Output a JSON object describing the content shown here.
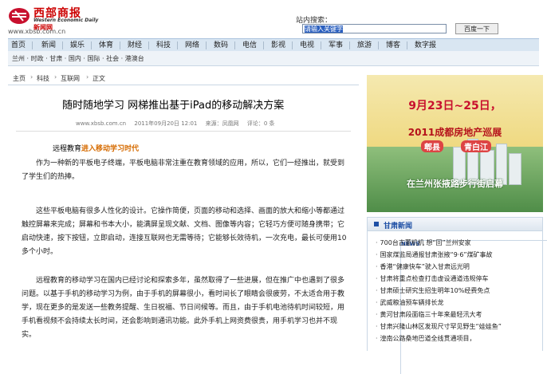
{
  "header": {
    "logo_cn": "西部商报",
    "logo_en": "Western Economic Daily",
    "logo_sub": "新闻网",
    "logo_news": "NEWS",
    "logo_url": "www.xbsb.com.cn",
    "search_label": "站内搜索：",
    "search_placeholder": "请输入关键字",
    "search_button": "百度一下"
  },
  "nav": {
    "items": [
      "首页",
      "新闻",
      "娱乐",
      "体育",
      "财经",
      "科技",
      "网络",
      "数码",
      "电信",
      "影视",
      "电视",
      "军事",
      "旅游",
      "博客",
      "数字报"
    ]
  },
  "subnav": {
    "text": "兰州 · 时政 · 甘肃 · 国内 · 国际 · 社会 · 港澳台"
  },
  "breadcrumb": {
    "items": [
      "主页",
      "科技",
      "互联网",
      "正文"
    ]
  },
  "article": {
    "title": "随时随地学习 网梯推出基于iPad的移动解决方案",
    "meta_site": "www.xbsb.com.cn",
    "meta_time": "2011年09月20日 12:01",
    "meta_source": "来源：凤凰网",
    "meta_comments": "评论：0 条",
    "lead_prefix": "远程教育",
    "lead_highlight": "进入移动学习时代",
    "paragraphs": [
      "作为一种新的平板电子终端，平板电脑非常注重在教育领域的应用，所以，它们一经推出，就受到了学生们的热捧。",
      "这些平板电脑有很多人性化的设计。它操作简便，页面的移动和选择、画面的放大和缩小等都通过触控屏幕来完成；屏幕和书本大小，能满屏呈现文献、文档、图像等内容；它轻巧方便可随身携带；它启动快速，按下按钮，立即启动，连接互联网也无需等待；它能够长效待机，一次充电，最长可使用10多个小时。",
      "远程教育的移动学习在国内已经讨论和探索多年，虽然取得了一些进展，但在推广中也遇到了很多问题。以基于手机的移动学习为例，由于手机的屏幕很小，看时间长了眼睛会很疲劳，不太适合用于教学，现在更多的是发送一些教务提醒、生日祝福、节日问候等。而且，由于手机电池待机时间较短，用手机看视频不会持续太长时间，还会影响到通讯功能。此外手机上网资费很贵，用手机学习也并不现实。"
    ]
  },
  "ad": {
    "date": "9月23日~25日，",
    "expo": "2011成都房地产巡展",
    "tag1": "郫县",
    "tag2": "青白江",
    "slogan": "在兰州张掖路步行街启幕"
  },
  "news_panel": {
    "title": "甘肃新闻",
    "items": [
      "700台古董机机 想“回”兰州安家",
      "国家煤监局通报甘肃张掖“9·6”煤矿事故",
      "香港“健康快车”驶入甘肃远光明",
      "甘肃将重点检查打击虚设通道违规停车",
      "甘肃硕士研究生招生明年10%经费免点",
      "武威粮油预车辆排长龙",
      "黄河甘肃段面临三十年来最轻汛大考",
      "甘肃兴隆山林区发现尺寸罕见野生“娃娃鱼”",
      "湟南公路桑地巴道全线贯通项目，"
    ]
  },
  "colors": {
    "accent_red": "#c8102e",
    "nav_bg": "#d9e6f2",
    "link_blue": "#1d4fa5",
    "lead_orange": "#d66b00"
  }
}
